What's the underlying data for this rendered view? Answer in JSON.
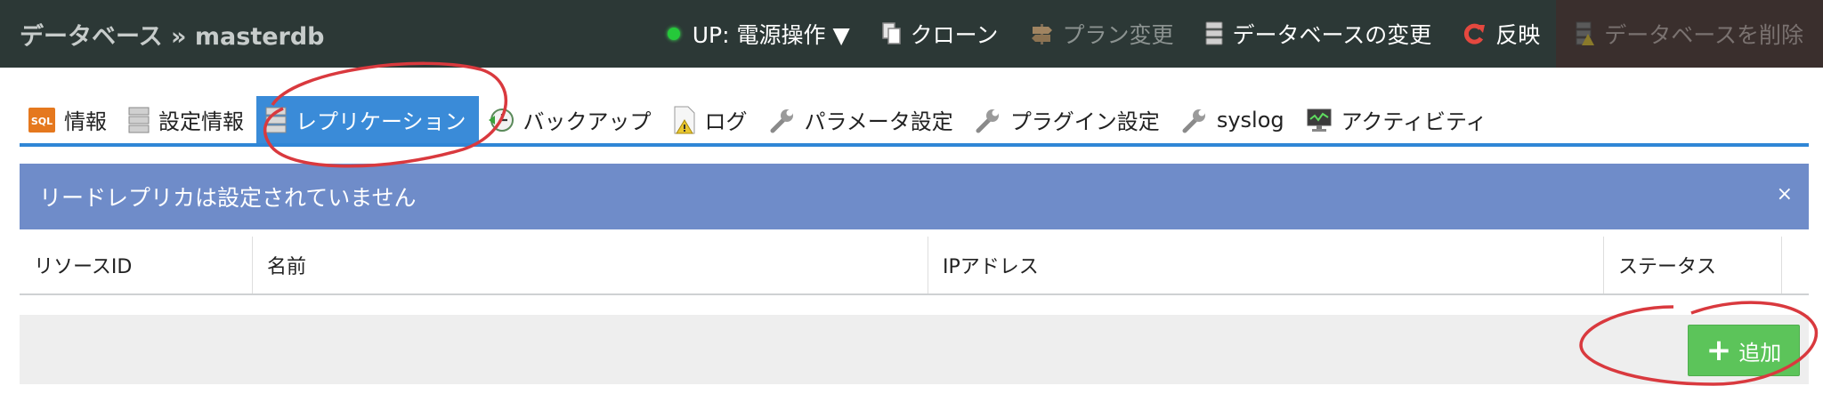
{
  "header": {
    "breadcrumb": "データベース » masterdb",
    "actions": {
      "power": "UP: 電源操作 ▼",
      "clone": "クローン",
      "plan_change": "プラン変更",
      "db_change": "データベースの変更",
      "apply": "反映",
      "delete": "データベースを削除"
    }
  },
  "tabs": {
    "info": "情報",
    "settings": "設定情報",
    "replication": "レプリケーション",
    "backup": "バックアップ",
    "log": "ログ",
    "params": "パラメータ設定",
    "plugins": "プラグイン設定",
    "syslog": "syslog",
    "activity": "アクティビティ"
  },
  "alert": {
    "message": "リードレプリカは設定されていません",
    "close": "×"
  },
  "table": {
    "columns": [
      "リソースID",
      "名前",
      "IPアドレス",
      "ステータス"
    ]
  },
  "footer": {
    "add_label": "追加"
  },
  "colors": {
    "topbar": "#2c3836",
    "tab_active": "#3a8bd8",
    "alert": "#6f8cc9",
    "add_button": "#5cc45a",
    "annotation": "#d9393e"
  },
  "icons": [
    "status-dot",
    "copy-icon",
    "signpost-icon",
    "database-icon",
    "refresh-icon",
    "sql-icon",
    "wrench-icon",
    "backup-clock-icon",
    "log-file-icon",
    "monitor-icon",
    "plus-icon"
  ]
}
